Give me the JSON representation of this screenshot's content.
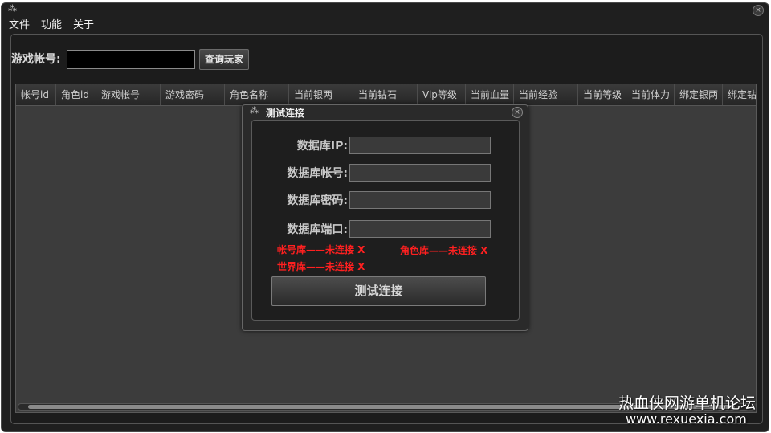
{
  "window": {
    "close_glyph": "×"
  },
  "menu": [
    "文件",
    "功能",
    "关于"
  ],
  "search": {
    "label": "游戏帐号:",
    "value": "",
    "button": "查询玩家"
  },
  "table": {
    "columns": [
      "帐号id",
      "角色id",
      "游戏帐号",
      "游戏密码",
      "角色名称",
      "当前银两",
      "当前钻石",
      "Vip等级",
      "当前血量",
      "当前经验",
      "当前等级",
      "当前体力",
      "绑定银两",
      "绑定钻"
    ]
  },
  "dialog": {
    "title": "测试连接",
    "fields": [
      {
        "label": "数据库IP:",
        "value": ""
      },
      {
        "label": "数据库帐号:",
        "value": ""
      },
      {
        "label": "数据库密码:",
        "value": ""
      },
      {
        "label": "数据库端口:",
        "value": ""
      }
    ],
    "status": {
      "account_db": "帐号库——未连接 X",
      "role_db": "角色库——未连接 X",
      "world_db": "世界库——未连接 X",
      "color": "#ff2020"
    },
    "button": "测试连接"
  },
  "watermark": {
    "line1": "热血侠网游单机论坛",
    "line2": "www.rexuexia.com"
  }
}
